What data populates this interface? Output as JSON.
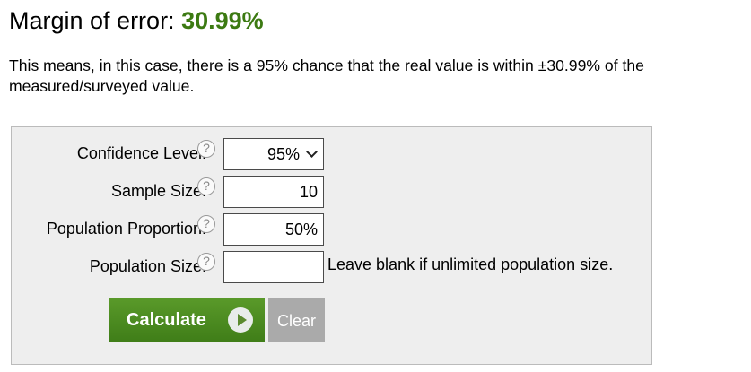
{
  "result": {
    "label": "Margin of error:",
    "value": "30.99%",
    "value_color": "#3c7a12"
  },
  "explanation": "This means, in this case, there is a 95% chance that the real value is within ±30.99% of the measured/surveyed value.",
  "form": {
    "confidence_level": {
      "label": "Confidence Level:",
      "help_icon": "question-circle-icon",
      "selected": "95%"
    },
    "sample_size": {
      "label": "Sample Size:",
      "help_icon": "question-circle-icon",
      "value": "10"
    },
    "population_proportion": {
      "label": "Population Proportion:",
      "help_icon": "question-circle-icon",
      "value": "50%"
    },
    "population_size": {
      "label": "Population Size:",
      "help_icon": "question-circle-icon",
      "value": "",
      "hint": "Leave blank if unlimited population size."
    },
    "help_glyph": "?",
    "buttons": {
      "calculate_label": "Calculate",
      "calculate_icon": "play-circle-icon",
      "clear_label": "Clear",
      "calculate_color": "#4a8a20",
      "clear_color": "#aaaaaa"
    }
  }
}
